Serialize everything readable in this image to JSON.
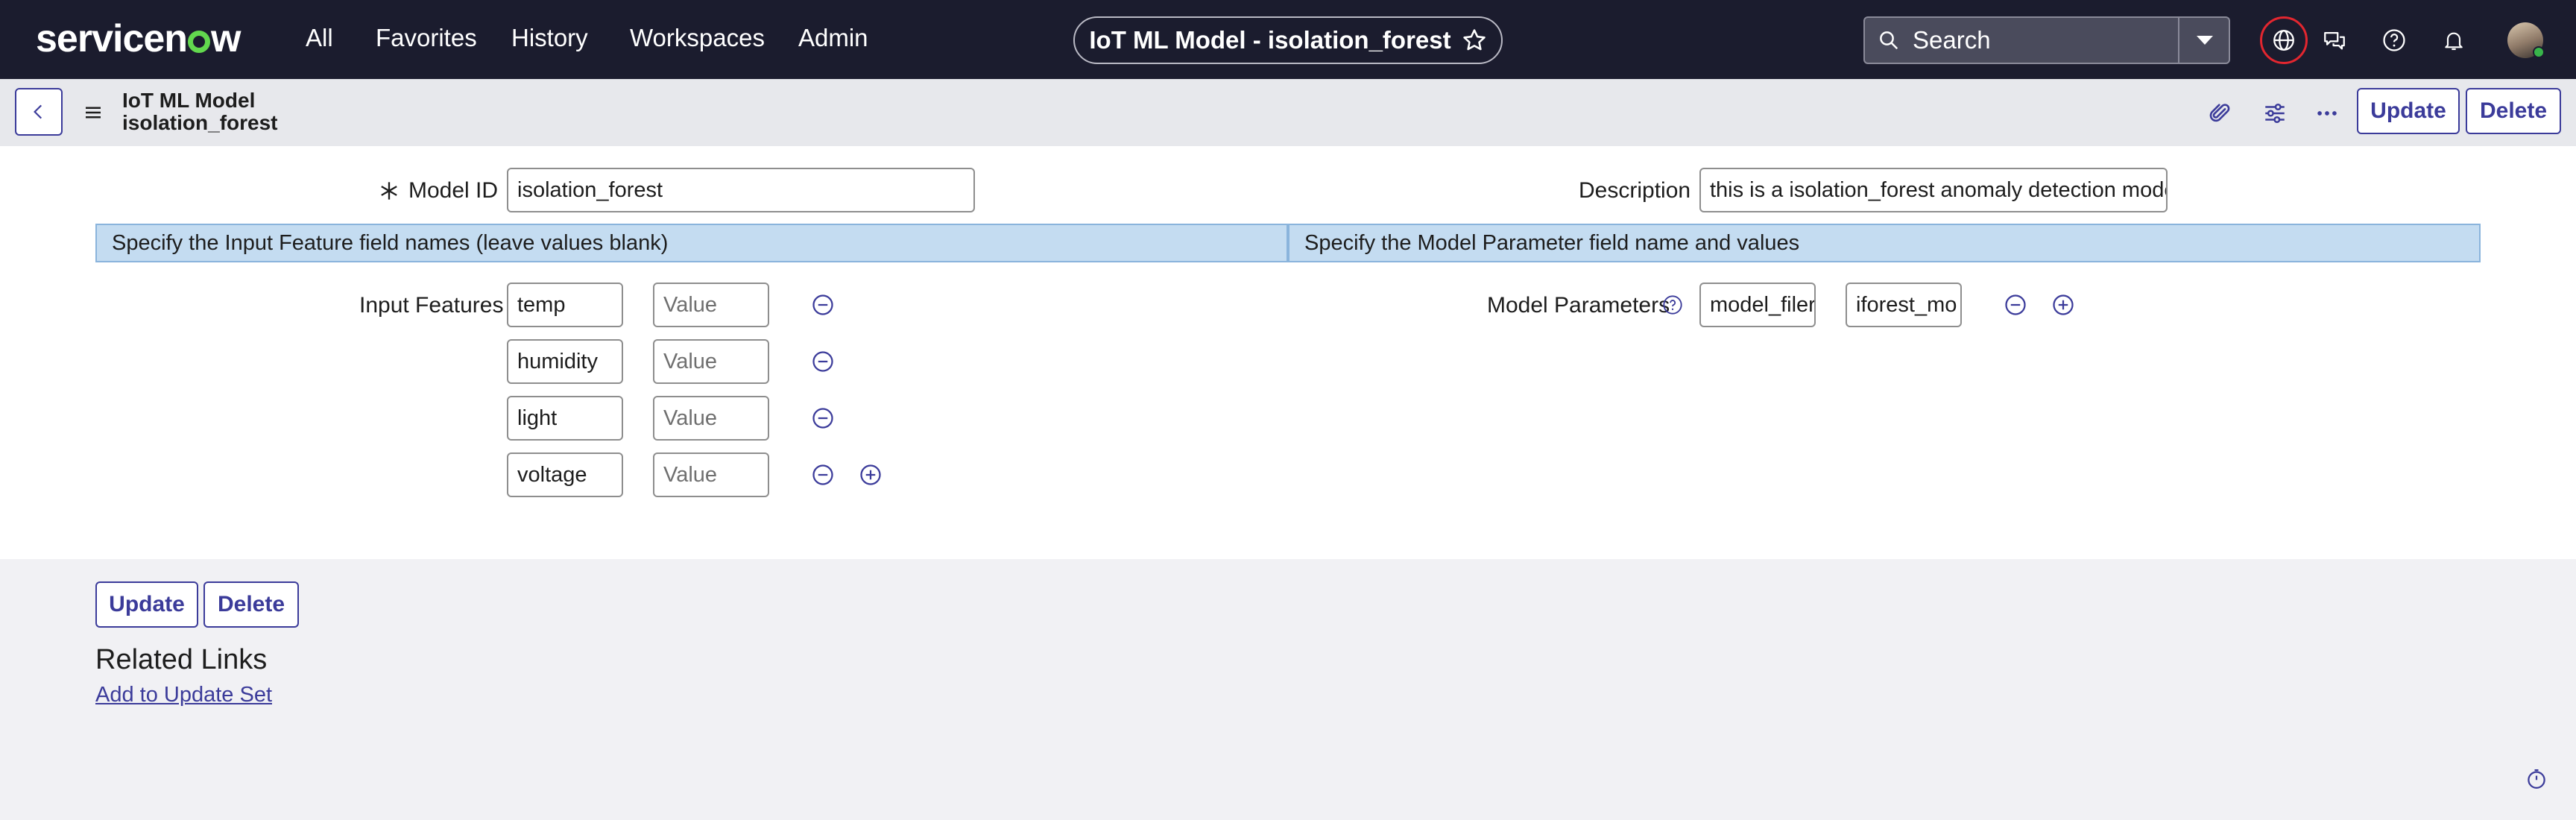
{
  "topbar": {
    "brand": "servicenow",
    "nav": [
      "All",
      "Favorites",
      "History",
      "Workspaces",
      "Admin"
    ],
    "record_title": "IoT ML Model - isolation_forest",
    "search_placeholder": "Search",
    "icons": [
      "globe-icon",
      "chat-icon",
      "help-icon",
      "bell-icon",
      "avatar"
    ]
  },
  "header": {
    "title_line1": "IoT ML Model",
    "title_line2": "isolation_forest",
    "update_label": "Update",
    "delete_label": "Delete"
  },
  "form": {
    "model_id_label": "Model ID",
    "model_id_value": "isolation_forest",
    "description_label": "Description",
    "description_value": "this is a isolation_forest anomaly detection model",
    "input_banner": "Specify the Input Feature field names (leave values blank)",
    "param_banner": "Specify the Model Parameter field name and values",
    "input_features_label": "Input Features",
    "input_features": [
      {
        "name": "temp",
        "value_placeholder": "Value"
      },
      {
        "name": "humidity",
        "value_placeholder": "Value"
      },
      {
        "name": "light",
        "value_placeholder": "Value"
      },
      {
        "name": "voltage",
        "value_placeholder": "Value"
      }
    ],
    "model_parameters_label": "Model Parameters",
    "model_parameters": [
      {
        "name": "model_filer",
        "value": "iforest_mo"
      }
    ]
  },
  "footer": {
    "update_label": "Update",
    "delete_label": "Delete",
    "related_links_title": "Related Links",
    "add_to_update_set": "Add to Update Set"
  },
  "colors": {
    "topbar_bg": "#1b1c2e",
    "brand_accent": "#62d84e",
    "button_text": "#3b3b9a",
    "banner_bg": "#c4dcf1"
  }
}
